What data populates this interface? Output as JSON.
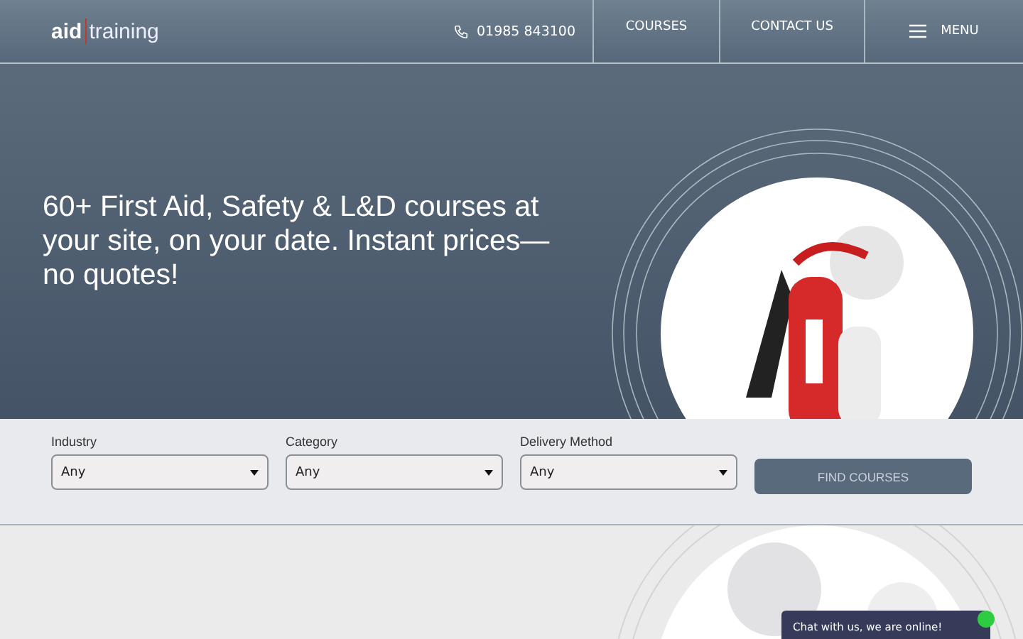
{
  "header": {
    "logo": {
      "bold": "aid",
      "light": "training"
    },
    "phone": "01985 843100",
    "nav": [
      {
        "label": "COURSES",
        "kind": "link"
      },
      {
        "label": "CONTACT US",
        "kind": "link"
      },
      {
        "label": "MENU",
        "kind": "menu"
      }
    ]
  },
  "hero": {
    "headline": "60+ First Aid, Safety & L&D courses at your site, on your date. Instant prices—no quotes!"
  },
  "filters": {
    "fields": [
      {
        "label": "Industry",
        "value": "Any"
      },
      {
        "label": "Category",
        "value": "Any"
      },
      {
        "label": "Delivery Method",
        "value": "Any"
      }
    ],
    "button": "FIND COURSES"
  },
  "chat": {
    "text": "Chat with us, we are online!"
  }
}
